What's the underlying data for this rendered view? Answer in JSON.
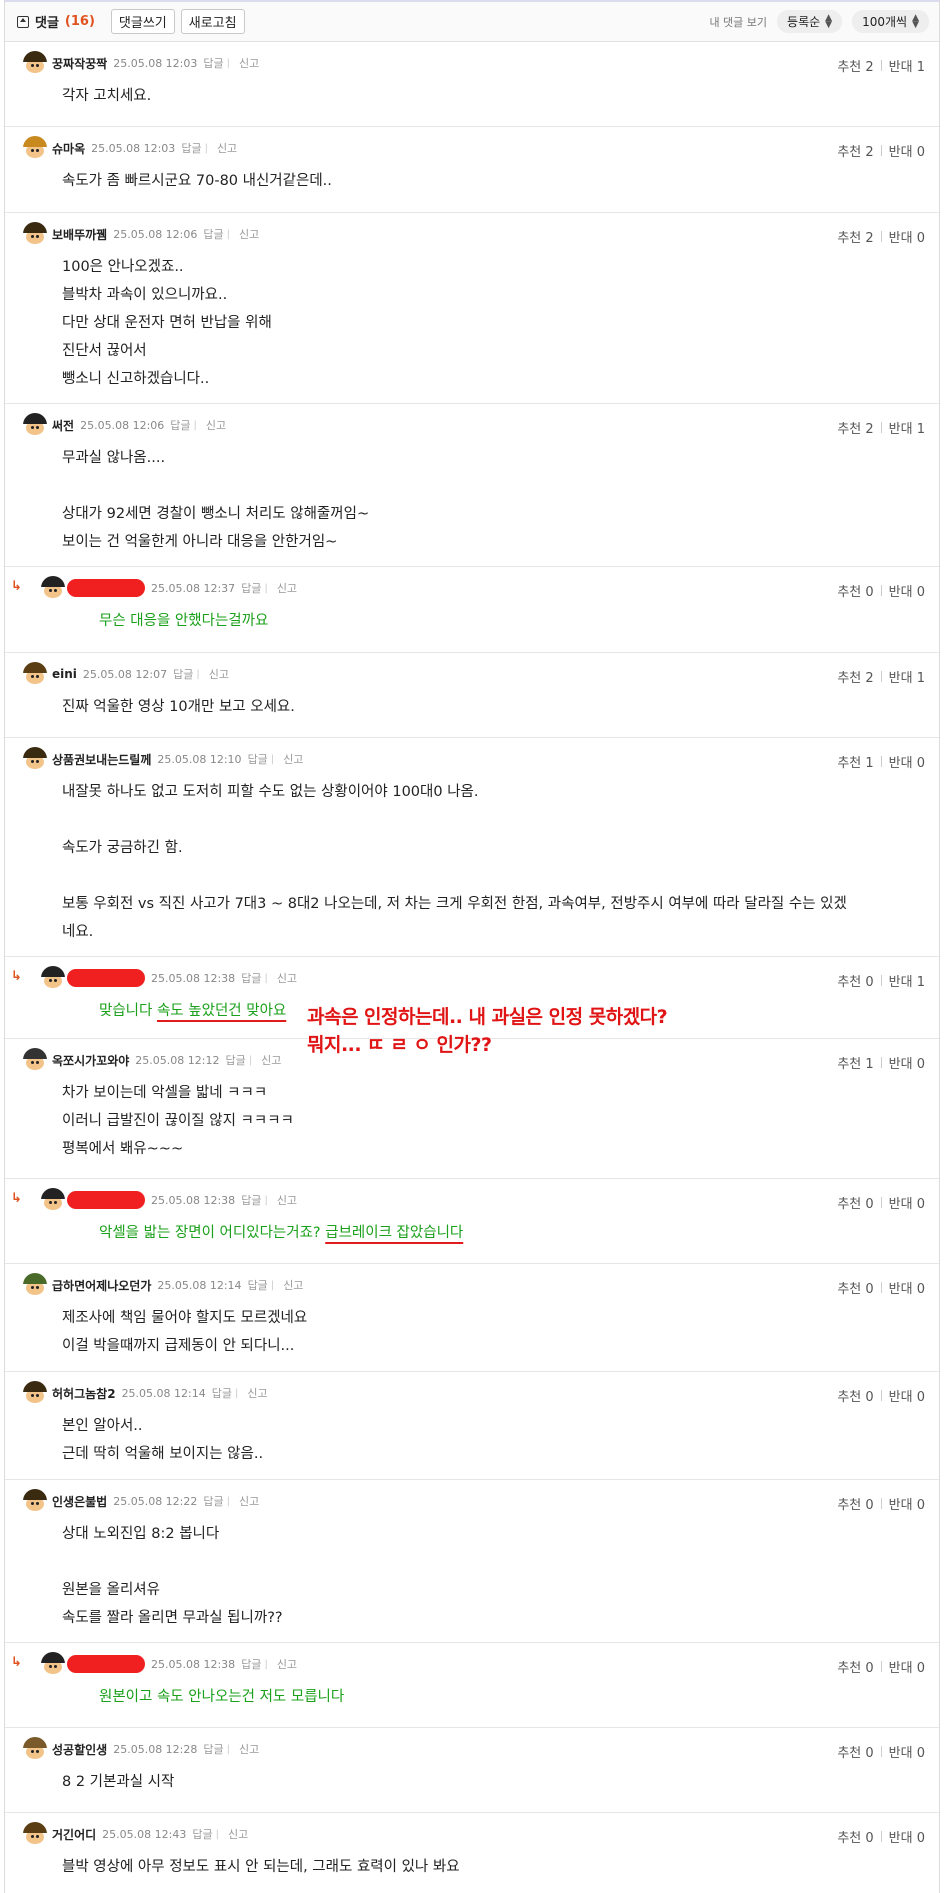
{
  "header": {
    "title": "댓글",
    "count": "(16)",
    "write_label": "댓글쓰기",
    "refresh_label": "새로고침",
    "my_comments_label": "내 댓글 보기",
    "sort_label": "등록순",
    "per_page_label": "100개씩"
  },
  "actions": {
    "reply": "답글",
    "report": "신고"
  },
  "vote_labels": {
    "up": "추천",
    "down": "반대"
  },
  "comments": [
    {
      "nick": "꿍짜작꿍짝",
      "date": "25.05.08 12:03",
      "up": "2",
      "down": "1",
      "lines": [
        "각자 고치세요."
      ]
    },
    {
      "nick": "슈마옥",
      "date": "25.05.08 12:03",
      "up": "2",
      "down": "0",
      "lines": [
        "속도가 좀 빠르시군요 70-80 내신거같은데.."
      ]
    },
    {
      "nick": "보배뚜까뀀",
      "date": "25.05.08 12:06",
      "up": "2",
      "down": "0",
      "lines": [
        "100은 안나오겠죠..",
        "블박차 과속이 있으니까요..",
        "다만 상대 운전자 면허 반납을 위해",
        "진단서 끊어서",
        "뺑소니 신고하겠습니다.."
      ]
    },
    {
      "nick": "써전",
      "date": "25.05.08 12:06",
      "up": "2",
      "down": "1",
      "lines": [
        "무과실 않나옴....",
        "",
        "상대가 92세면 경찰이 뺑소니 처리도 않해줄꺼임~",
        "보이는 건 억울한게 아니라 대응을 안한거임~"
      ]
    },
    {
      "nick": "",
      "date": "25.05.08 12:37",
      "up": "0",
      "down": "0",
      "lines": [
        "무슨 대응을 안했다는걸까요"
      ]
    },
    {
      "nick": "eini",
      "date": "25.05.08 12:07",
      "up": "2",
      "down": "1",
      "lines": [
        "진짜 억울한 영상 10개만 보고 오세요."
      ]
    },
    {
      "nick": "상품권보내는드릴께",
      "date": "25.05.08 12:10",
      "up": "1",
      "down": "0",
      "lines": [
        "내잘못 하나도 없고 도저히 피할 수도 없는 상황이어야 100대0 나옴.",
        "",
        "속도가 궁금하긴 함.",
        "",
        "보통 우회전 vs 직진 사고가 7대3 ~ 8대2 나오는데, 저 차는 크게 우회전 한점, 과속여부, 전방주시 여부에 따라 달라질 수는 있겠",
        "네요."
      ]
    },
    {
      "nick": "",
      "date": "25.05.08 12:38",
      "up": "0",
      "down": "1",
      "lines": [],
      "pre": "맞습니다 ",
      "underlined": "속도 높았던건 맞아요",
      "post": ""
    },
    {
      "nick": "옥쪼시가꼬와야",
      "date": "25.05.08 12:12",
      "up": "1",
      "down": "0",
      "lines": [
        "차가 보이는데 악셀을 밟네 ㅋㅋㅋ",
        "이러니 급발진이 끊이질 않지 ㅋㅋㅋㅋ",
        "평복에서 봬유~~~"
      ]
    },
    {
      "nick": "",
      "date": "25.05.08 12:38",
      "up": "0",
      "down": "0",
      "lines": [],
      "pre": "악셀을 밟는 장면이 어디있다는거죠? ",
      "underlined": "급브레이크 잡았습니다",
      "post": ""
    },
    {
      "nick": "급하면어제나오던가",
      "date": "25.05.08 12:14",
      "up": "0",
      "down": "0",
      "lines": [
        "제조사에 책임 물어야 할지도 모르겠네요",
        "이걸 박을때까지 급제동이 안 되다니..."
      ]
    },
    {
      "nick": "허허그놈참2",
      "date": "25.05.08 12:14",
      "up": "0",
      "down": "0",
      "lines": [
        "본인 알아서..",
        "근데 딱히 억울해 보이지는 않음.."
      ]
    },
    {
      "nick": "인생은불법",
      "date": "25.05.08 12:22",
      "up": "0",
      "down": "0",
      "lines": [
        "상대 노외진입 8:2 봅니다",
        "",
        "원본을 올리셔유",
        "속도를 짤라 올리면 무과실 됩니까??"
      ]
    },
    {
      "nick": "",
      "date": "25.05.08 12:38",
      "up": "0",
      "down": "0",
      "lines": [
        "원본이고 속도 안나오는건 저도 모릅니다"
      ]
    },
    {
      "nick": "성공할인생",
      "date": "25.05.08 12:28",
      "up": "0",
      "down": "0",
      "lines": [
        "8 2 기본과실 시작"
      ]
    },
    {
      "nick": "거긴어디",
      "date": "25.05.08 12:43",
      "up": "0",
      "down": "0",
      "lines": [
        "블박 영상에 아무 정보도 표시 안 되는데, 그래도 효력이 있나 봐요"
      ]
    }
  ],
  "annotation": [
    "과속은 인정하는데.. 내 과실은 인정 못하겠다?",
    "뭐지... ㄸ ㄹ ㅇ 인가??"
  ],
  "colors": {
    "accent": "#e0521f",
    "reply_text": "#1aa01a",
    "redaction": "#f02020",
    "annotation": "#e01414"
  }
}
